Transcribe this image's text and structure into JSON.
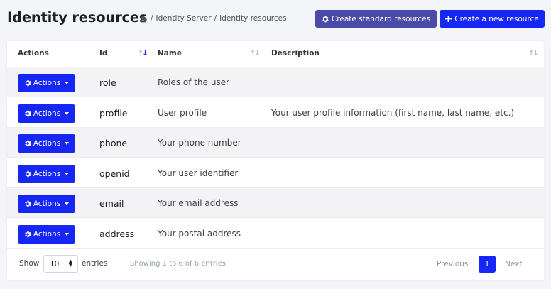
{
  "header": {
    "title": "Identity resources",
    "breadcrumb": [
      "Identity Server",
      "Identity resources"
    ],
    "btn_standard": "Create standard resources",
    "btn_new": "Create a new resource"
  },
  "table": {
    "columns": [
      "Actions",
      "Id",
      "Name",
      "Description"
    ],
    "action_label": "Actions",
    "rows": [
      {
        "id": "role",
        "name": "Roles of the user",
        "description": ""
      },
      {
        "id": "profile",
        "name": "User profile",
        "description": "Your user profile information (first name, last name, etc.)"
      },
      {
        "id": "phone",
        "name": "Your phone number",
        "description": ""
      },
      {
        "id": "openid",
        "name": "Your user identifier",
        "description": ""
      },
      {
        "id": "email",
        "name": "Your email address",
        "description": ""
      },
      {
        "id": "address",
        "name": "Your postal address",
        "description": ""
      }
    ]
  },
  "footer": {
    "show": "Show",
    "page_size": "10",
    "entries": "entries",
    "info": "Showing 1 to 6 of 6 entries",
    "previous": "Previous",
    "current_page": "1",
    "next": "Next"
  },
  "colors": {
    "primary": "#1526f5",
    "secondary": "#4c4aa8"
  },
  "icons": [
    "home-icon",
    "gear-icon",
    "plus-icon",
    "caret-down-icon",
    "sort-icon",
    "select-arrows-icon"
  ]
}
